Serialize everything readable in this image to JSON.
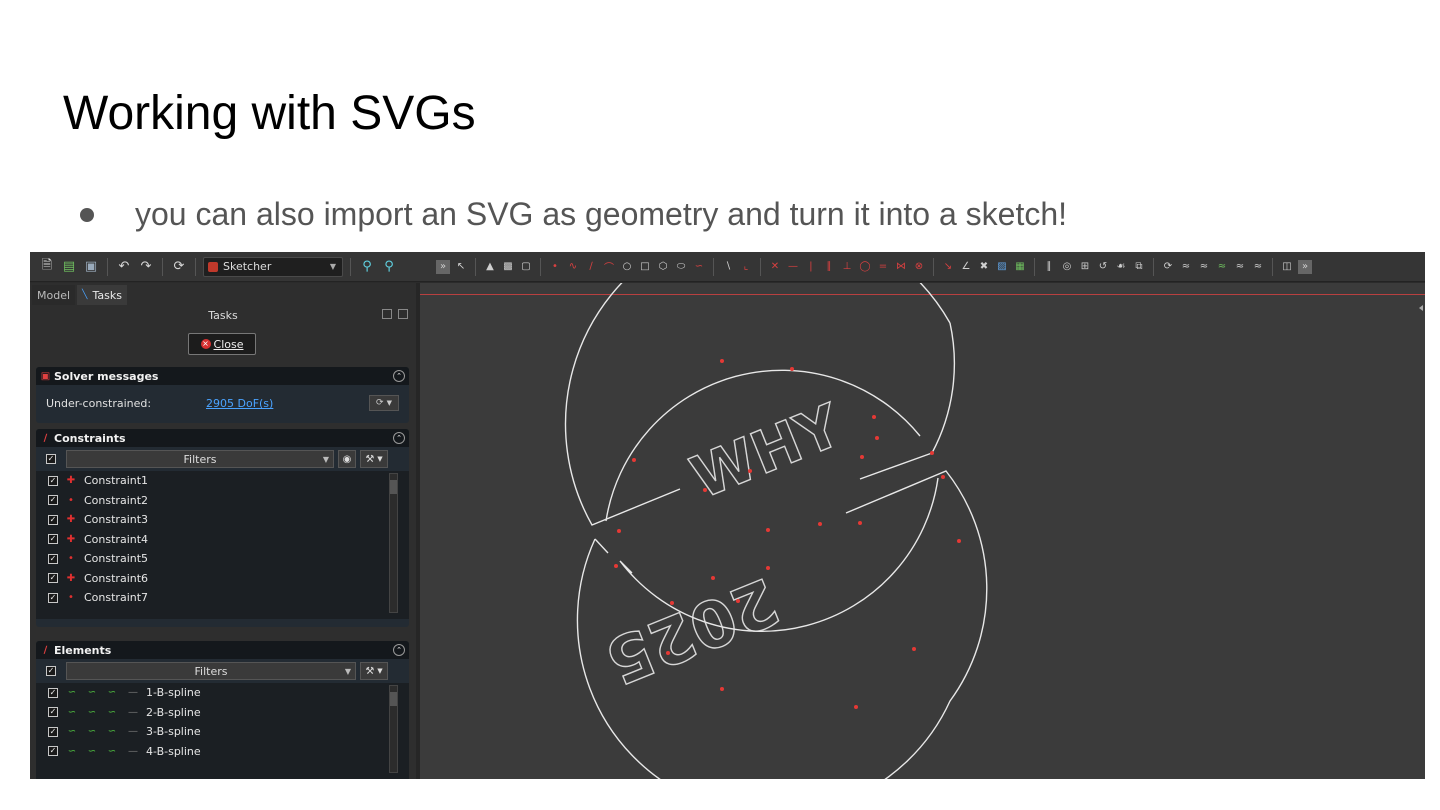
{
  "slide": {
    "title": "Working with SVGs",
    "bullet": "you can also import an SVG as geometry and turn it into a sketch!"
  },
  "toolbar": {
    "workbench": "Sketcher",
    "left_icons": [
      "new-file-icon",
      "open-file-icon",
      "save-icon",
      "undo-icon",
      "redo-icon",
      "refresh-icon"
    ],
    "zoom_icons": [
      "zoom-fit-icon",
      "zoom-in-icon"
    ]
  },
  "left_panel": {
    "tabs": [
      "Model",
      "Tasks"
    ],
    "active_tab": "Tasks",
    "header": "Tasks",
    "close_label": "Close",
    "solver": {
      "title": "Solver messages",
      "status_label": "Under-constrained:",
      "dof_link": "2905 DoF(s)"
    },
    "constraints": {
      "title": "Constraints",
      "filter_label": "Filters",
      "items": [
        "Constraint1",
        "Constraint2",
        "Constraint3",
        "Constraint4",
        "Constraint5",
        "Constraint6",
        "Constraint7"
      ]
    },
    "elements": {
      "title": "Elements",
      "filter_label": "Filters",
      "items": [
        "1-B-spline",
        "2-B-spline",
        "3-B-spline",
        "4-B-spline"
      ]
    }
  },
  "canvas": {
    "sketch_text_top": "WHY",
    "sketch_text_bottom": "2025",
    "line_color": "#e8e8e8",
    "point_color": "#e53935",
    "background": "#3b3b3b"
  }
}
